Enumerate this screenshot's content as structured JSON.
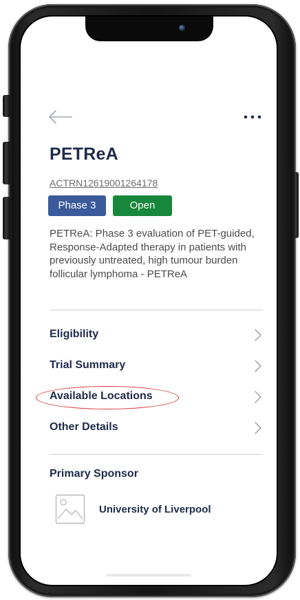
{
  "trial": {
    "title": "PETReA",
    "registry_id": "ACTRN12619001264178",
    "phase_badge": "Phase 3",
    "status_badge": "Open",
    "description": "PETReA: Phase 3 evaluation of PET-guided, Response-Adapted therapy in patients with previously untreated, high tumour burden follicular lymphoma - PETReA"
  },
  "nav": {
    "items": [
      {
        "label": "Eligibility"
      },
      {
        "label": "Trial Summary"
      },
      {
        "label": "Available Locations"
      },
      {
        "label": "Other Details"
      }
    ]
  },
  "sponsor": {
    "heading": "Primary Sponsor",
    "name": "University of Liverpool"
  },
  "icons": {
    "back": "arrow-left-icon",
    "menu": "more-horizontal-icon",
    "chevron": "chevron-right-icon",
    "sponsor_logo": "image-placeholder-icon"
  },
  "colors": {
    "title_text": "#1f2a4a",
    "phase_badge": "#3a5a9a",
    "status_badge": "#17873c",
    "highlight": "#d23a3a"
  }
}
